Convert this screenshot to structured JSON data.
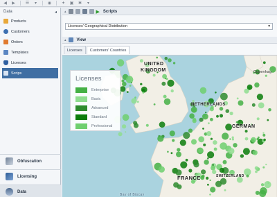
{
  "sidebar": {
    "header": "Data",
    "collapse_glyph": "◂",
    "items": [
      {
        "label": "Products",
        "icon": "folder-icon",
        "color": "#e8a83a"
      },
      {
        "label": "Customers",
        "icon": "user-icon",
        "color": "#3d6fb0"
      },
      {
        "label": "Orders",
        "icon": "orders-icon",
        "color": "#e07a2f"
      },
      {
        "label": "Templates",
        "icon": "template-icon",
        "color": "#5b86c2"
      },
      {
        "label": "Licenses",
        "icon": "license-icon",
        "color": "#2f5fa0"
      },
      {
        "label": "Scrips",
        "icon": "script-icon",
        "color": "#d7e3f2"
      }
    ],
    "sections": [
      {
        "label": "Obfuscation"
      },
      {
        "label": "Licensing"
      },
      {
        "label": "Data"
      }
    ]
  },
  "scripts_panel": {
    "title": "Scripts",
    "selected_script": "Licenses' Geographical Distribution",
    "dropdown_glyph": "▾"
  },
  "view_panel": {
    "title": "View",
    "tabs": [
      {
        "label": "Licenses"
      },
      {
        "label": "Customers' Countries"
      }
    ]
  },
  "map": {
    "labels": {
      "uk1": "UNITED",
      "uk2": "KINGDOM",
      "netherlands": "NETHERLANDS",
      "germany": "GERMAN",
      "france": "FRANCE",
      "switzerland": "SWITZERLAND",
      "bay": "Bay of Biscay",
      "copenhagen": "Copenhag"
    }
  },
  "legend": {
    "title": "Licenses",
    "items": [
      {
        "label": "Enterprise",
        "color": "#45b045"
      },
      {
        "label": "Basic",
        "color": "#8fdd8f"
      },
      {
        "label": "Advanced",
        "color": "#2e8b2e"
      },
      {
        "label": "Standard",
        "color": "#0b7d0b"
      },
      {
        "label": "Professional",
        "color": "#6fcf6f"
      }
    ]
  }
}
